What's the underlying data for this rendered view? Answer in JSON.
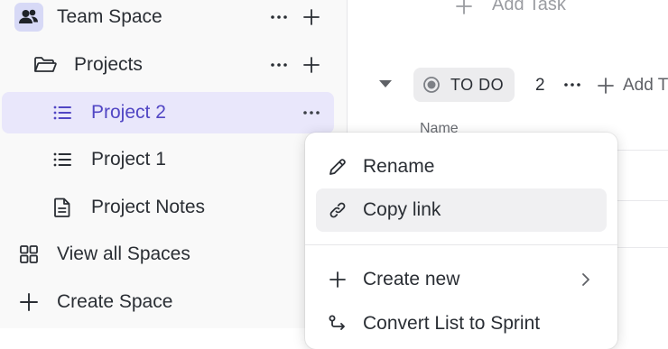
{
  "sidebar": {
    "team_space": {
      "label": "Team Space",
      "avatar_icon": "people-icon",
      "more_icon": "more-horizontal-icon",
      "add_icon": "plus-icon"
    },
    "projects_folder": {
      "label": "Projects",
      "icon": "folder-open-icon",
      "more_icon": "more-horizontal-icon",
      "add_icon": "plus-icon"
    },
    "items": [
      {
        "label": "Project 2",
        "icon": "list-icon",
        "selected": true
      },
      {
        "label": "Project 1",
        "icon": "list-icon",
        "selected": false
      },
      {
        "label": "Project Notes",
        "icon": "document-icon",
        "selected": false
      }
    ],
    "view_all_spaces": {
      "label": "View all Spaces",
      "icon": "grid-icon"
    },
    "create_space": {
      "label": "Create Space",
      "icon": "plus-icon"
    }
  },
  "main": {
    "add_task_top": "Add Task",
    "group": {
      "status": "TO DO",
      "count": "2",
      "add_task_truncated": "Add T"
    },
    "column_name": "Name"
  },
  "context_menu": {
    "items": [
      {
        "label": "Rename",
        "icon": "pencil-icon"
      },
      {
        "label": "Copy link",
        "icon": "link-icon",
        "hovered": true
      },
      {
        "label": "Create new",
        "icon": "plus-icon",
        "has_submenu": true
      },
      {
        "label": "Convert List to Sprint",
        "icon": "convert-icon"
      }
    ]
  },
  "colors": {
    "accent": "#5146c4",
    "selected_bg": "#e9e7fb",
    "sidebar_bg": "#f9f9f9",
    "hover_bg": "#f0f0f2",
    "text": "#2a2e34",
    "muted": "#9a9ca1"
  }
}
